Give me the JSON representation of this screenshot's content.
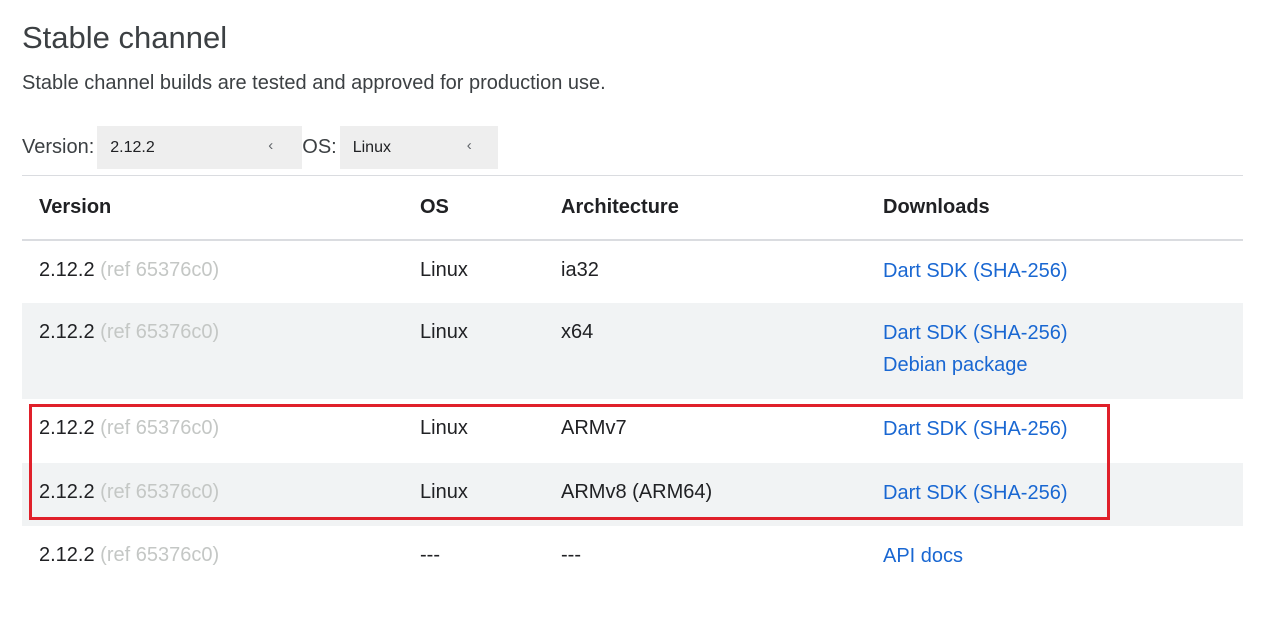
{
  "header": {
    "title": "Stable channel",
    "subtitle": "Stable channel builds are tested and approved for production use."
  },
  "filters": {
    "version_label": "Version:",
    "version_value": "2.12.2",
    "os_label": "OS:",
    "os_value": "Linux",
    "chevron_icon": "chevron-left-icon"
  },
  "table": {
    "headers": [
      "Version",
      "OS",
      "Architecture",
      "Downloads"
    ],
    "rows": [
      {
        "version": "2.12.2",
        "ref": "(ref 65376c0)",
        "os": "Linux",
        "arch": "ia32",
        "downloads": [
          "Dart SDK (SHA-256)"
        ]
      },
      {
        "version": "2.12.2",
        "ref": "(ref 65376c0)",
        "os": "Linux",
        "arch": "x64",
        "downloads": [
          "Dart SDK (SHA-256)",
          "Debian package"
        ]
      },
      {
        "version": "2.12.2",
        "ref": "(ref 65376c0)",
        "os": "Linux",
        "arch": "ARMv7",
        "downloads": [
          "Dart SDK (SHA-256)"
        ]
      },
      {
        "version": "2.12.2",
        "ref": "(ref 65376c0)",
        "os": "Linux",
        "arch": "ARMv8 (ARM64)",
        "downloads": [
          "Dart SDK (SHA-256)"
        ]
      },
      {
        "version": "2.12.2",
        "ref": "(ref 65376c0)",
        "os": "---",
        "arch": "---",
        "downloads": [
          "API docs"
        ]
      }
    ]
  },
  "colors": {
    "link": "#1967d2",
    "row_shade": "#f1f3f4",
    "highlight_border": "#e0202a",
    "ref_text": "#c4c7c5"
  }
}
